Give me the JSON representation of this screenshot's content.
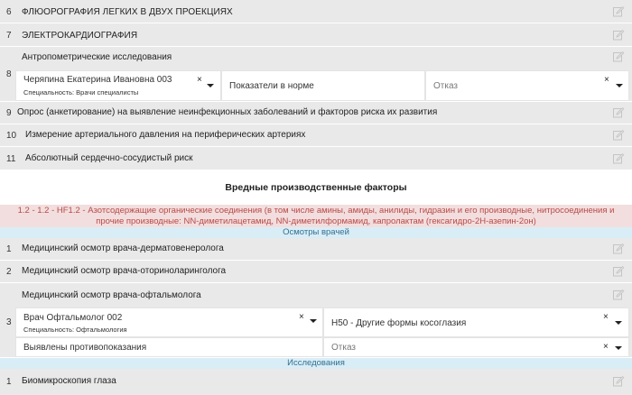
{
  "exams_top": [
    {
      "num": "6",
      "label": "ФЛЮОРОГРАФИЯ ЛЕГКИХ В ДВУХ ПРОЕКЦИЯХ"
    },
    {
      "num": "7",
      "label": "ЭЛЕКТРОКАРДИОГРАФИЯ"
    }
  ],
  "anthropometry": {
    "num": "8",
    "label": "Антропометрические исследования",
    "doctor_value": "Черяпина Екатерина Ивановна 003",
    "doctor_specialty": "Специальность: Врачи специалисты",
    "clear_symbol": "×",
    "result_value": "Показатели в норме",
    "refusal_placeholder": "Отказ"
  },
  "exams_mid": [
    {
      "num": "9",
      "label": "Опрос (анкетирование) на выявление неинфекционных заболеваний и факторов риска их развития"
    },
    {
      "num": "10",
      "label": "Измерение артериального давления на периферических артериях"
    },
    {
      "num": "11",
      "label": "Абсолютный сердечно-сосудистый риск"
    }
  ],
  "harmful_section": {
    "title": "Вредные производственные факторы",
    "factor_line1": "1.2 - 1.2 - HF1.2 - Азотсодержащие органические соединения (в том числе амины, амиды, анилиды, гидразин и его производные, нитросоединения и",
    "factor_line2": "прочие производные: NN-диметилацетамид, NN-диметилформамид, капролактам (гексагидро-2Н-азепин-2он)",
    "doctors_header": "Осмотры врачей",
    "research_header": "Исследования"
  },
  "doctor_exams": [
    {
      "num": "1",
      "label": "Медицинский осмотр врача-дерматовенеролога"
    },
    {
      "num": "2",
      "label": "Медицинский осмотр врача-оториноларинголога"
    }
  ],
  "ophthalmology": {
    "num": "3",
    "label": "Медицинский осмотр врача-офтальмолога",
    "doctor_value": "Врач Офтальмолог 002",
    "doctor_specialty": "Специальность: Офтальмология",
    "diagnosis_value": "H50 - Другие формы косоглазия",
    "conclusion_value": "Выявлены противопоказания",
    "refusal_placeholder": "Отказ",
    "clear_symbol": "×"
  },
  "research_exams": [
    {
      "num": "1",
      "label": "Биомикроскопия глаза"
    }
  ],
  "colors": {
    "row_bg": "#e9e9e9",
    "alert_bg": "#f2dede",
    "alert_text": "#b94a48",
    "info_bg": "#d9edf7",
    "info_text": "#31708f"
  },
  "icons": {
    "edit": "pencil-square-icon",
    "dropdown": "caret-down-icon",
    "clear": "clear-x-icon"
  }
}
